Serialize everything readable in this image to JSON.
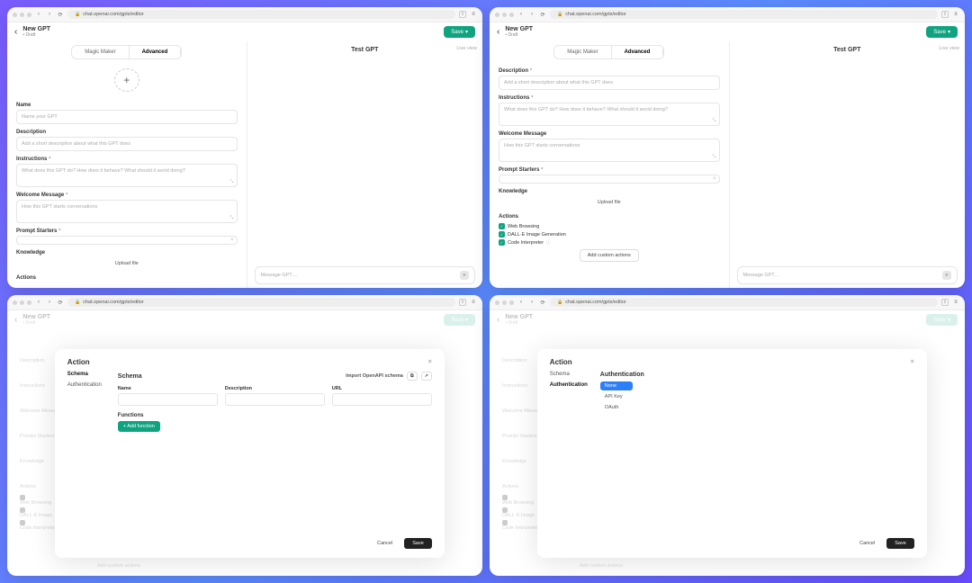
{
  "global": {
    "url": "chat.openai.com/gpts/editor",
    "header": {
      "title": "New GPT",
      "subtitle": "• Draft",
      "save": "Save"
    },
    "tabs": {
      "magic": "Magic Maker",
      "advanced": "Advanced"
    },
    "test": {
      "title": "Test GPT",
      "live": "Live view",
      "placeholder": "Message GPT…"
    }
  },
  "panel1": {
    "name_label": "Name",
    "name_ph": "Name your GPT",
    "desc_label": "Description",
    "desc_ph": "Add a short description about what this GPT does",
    "instr_label": "Instructions",
    "instr_ph": "What does this GPT do? How does it behave? What should it avoid doing?",
    "welcome_label": "Welcome Message",
    "welcome_ph": "How this GPT starts conversations",
    "ps_label": "Prompt Starters",
    "knowledge_label": "Knowledge",
    "upload": "Upload file",
    "actions_label": "Actions"
  },
  "panel2": {
    "desc_label": "Description",
    "desc_ph": "Add a short description about what this GPT does",
    "instr_label": "Instructions",
    "instr_ph": "What does this GPT do? How does it behave? What should it avoid doing?",
    "welcome_label": "Welcome Message",
    "welcome_ph": "How this GPT starts conversations",
    "ps_label": "Prompt Starters",
    "knowledge_label": "Knowledge",
    "upload": "Upload file",
    "actions_label": "Actions",
    "caps": [
      "Web Browsing",
      "DALL·E Image Generation",
      "Code Interpreter"
    ],
    "add_custom": "Add custom actions"
  },
  "modal_schema": {
    "title": "Action",
    "nav": [
      "Schema",
      "Authentication"
    ],
    "schema_head": "Schema",
    "import": "Import OpenAPI schema",
    "cols": [
      "Name",
      "Description",
      "URL"
    ],
    "functions": "Functions",
    "add_fn": "+ Add function",
    "cancel": "Cancel",
    "save": "Save"
  },
  "modal_auth": {
    "title": "Action",
    "nav": [
      "Schema",
      "Authentication"
    ],
    "auth_head": "Authentication",
    "opts": [
      "None",
      "API Key",
      "OAuth"
    ],
    "cancel": "Cancel",
    "save": "Save"
  },
  "bg_labels": [
    "Description",
    "Instructions",
    "Welcome Message",
    "Prompt Starters",
    "Knowledge",
    "Actions"
  ],
  "bg_caps": [
    "Web Browsing",
    "DALL·E Image",
    "Code Interpreter"
  ],
  "bg_custom": "Add custom actions"
}
